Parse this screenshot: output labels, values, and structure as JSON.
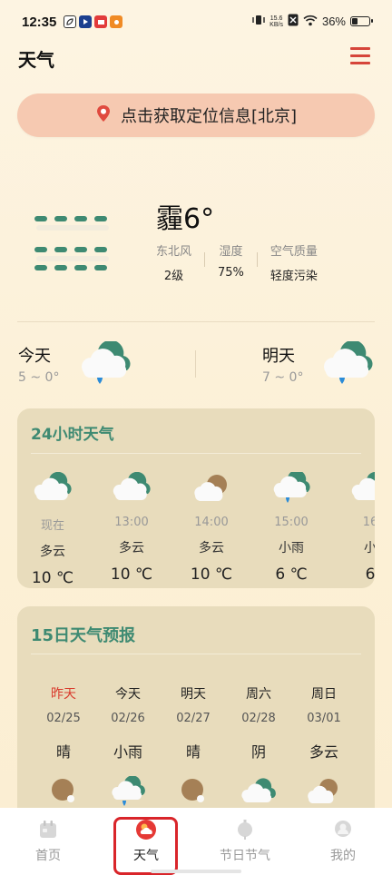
{
  "status_bar": {
    "time": "12:35",
    "net_speed_top": "15.6",
    "net_speed_bottom": "KB/s",
    "battery": "36%"
  },
  "header": {
    "title": "天气"
  },
  "location": {
    "label": "点击获取定位信息[北京]"
  },
  "current": {
    "condition_temp": "霾6°",
    "details": [
      {
        "label": "东北风",
        "value": "2级"
      },
      {
        "label": "湿度",
        "value": "75%"
      },
      {
        "label": "空气质量",
        "value": "轻度污染"
      }
    ]
  },
  "today": {
    "name": "今天",
    "range": "5 ~ 0°"
  },
  "tomorrow": {
    "name": "明天",
    "range": "7 ~ 0°"
  },
  "hourly": {
    "title": "24小时天气",
    "items": [
      {
        "time": "现在",
        "cond": "多云",
        "temp": "10 ℃",
        "icon": "cloud-icon"
      },
      {
        "time": "13:00",
        "cond": "多云",
        "temp": "10 ℃",
        "icon": "cloud-icon"
      },
      {
        "time": "14:00",
        "cond": "多云",
        "temp": "10 ℃",
        "icon": "partly-cloudy-icon"
      },
      {
        "time": "15:00",
        "cond": "小雨",
        "temp": "6 ℃",
        "icon": "light-rain-icon"
      },
      {
        "time": "16",
        "cond": "小",
        "temp": "6",
        "icon": "cloud-icon"
      }
    ]
  },
  "forecast15": {
    "title": "15日天气预报",
    "items": [
      {
        "name": "昨天",
        "date": "02/25",
        "cond": "晴",
        "icon": "sunny-icon"
      },
      {
        "name": "今天",
        "date": "02/26",
        "cond": "小雨",
        "icon": "light-rain-icon"
      },
      {
        "name": "明天",
        "date": "02/27",
        "cond": "晴",
        "icon": "sunny-icon"
      },
      {
        "name": "周六",
        "date": "02/28",
        "cond": "阴",
        "icon": "overcast-icon"
      },
      {
        "name": "周日",
        "date": "03/01",
        "cond": "多云",
        "icon": "partly-cloudy-icon"
      }
    ]
  },
  "nav": {
    "home": "首页",
    "weather": "天气",
    "festival": "节日节气",
    "mine": "我的"
  },
  "colors": {
    "accent_green": "#3e8a72",
    "location_bg": "#f6c9b1",
    "card_bg": "#e8dcbc",
    "highlight_red": "#d9252a"
  }
}
